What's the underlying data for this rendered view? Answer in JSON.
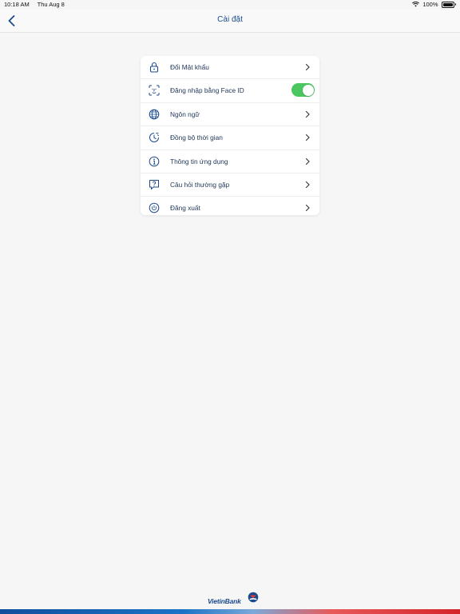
{
  "status_bar": {
    "time": "10:18 AM",
    "date": "Thu Aug 8",
    "battery": "100%"
  },
  "nav": {
    "title": "Cài đặt"
  },
  "settings": {
    "items": [
      {
        "label": "Đổi Mật khẩu",
        "icon": "lock-icon",
        "accessory": "chevron"
      },
      {
        "label": "Đăng nhập bằng Face ID",
        "icon": "face-id-icon",
        "accessory": "toggle",
        "toggle_on": true
      },
      {
        "label": "Ngôn ngữ",
        "icon": "globe-icon",
        "accessory": "chevron"
      },
      {
        "label": "Đồng bộ thời gian",
        "icon": "clock-sync-icon",
        "accessory": "chevron"
      },
      {
        "label": "Thông tin ứng dụng",
        "icon": "info-icon",
        "accessory": "chevron"
      },
      {
        "label": "Câu hỏi thường gặp",
        "icon": "faq-icon",
        "accessory": "chevron"
      },
      {
        "label": "Đăng xuất",
        "icon": "logout-icon",
        "accessory": "chevron"
      }
    ]
  },
  "brand": {
    "name": "VietinBank"
  },
  "colors": {
    "accent": "#1b4a8c",
    "toggle_on": "#4cc760",
    "background": "#f6f6f7"
  }
}
